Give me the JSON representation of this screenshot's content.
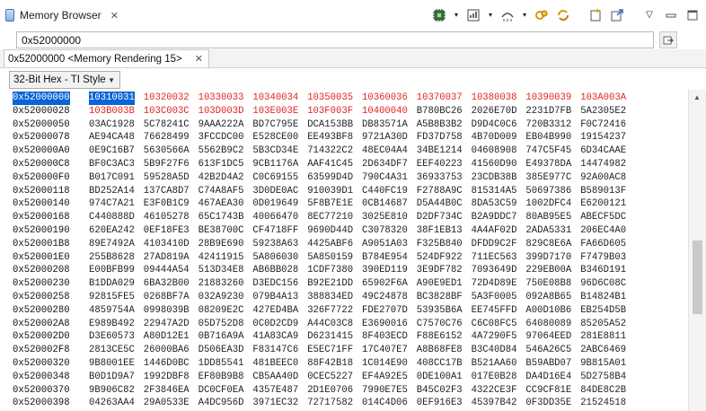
{
  "view": {
    "title": "Memory Browser",
    "close": "✕"
  },
  "toolbar": {
    "icons": [
      "chip-icon",
      "memory-map-icon",
      "chevron-down-icon",
      "interconnect-icon",
      "chevron-down-icon",
      "refresh-linked-icon",
      "sync-icon",
      "new-view-icon",
      "export-icon",
      "view-menu-icon",
      "minimize-icon",
      "maximize-icon"
    ]
  },
  "address_bar": {
    "value": "0x52000000",
    "go_icon": "go-icon"
  },
  "rendering_tab": {
    "label": "0x52000000 <Memory Rendering 15>",
    "close": "✕"
  },
  "format_select": {
    "selected": "32-Bit Hex - TI Style",
    "arrow": "▼"
  },
  "memory": {
    "rows": [
      {
        "addr": "0x52000000",
        "cells": [
          "10310031",
          "10320032",
          "10330033",
          "10340034",
          "10350035",
          "10360036",
          "10370037",
          "10380038",
          "10390039",
          "103A003A"
        ],
        "changed": [
          1,
          2,
          3,
          4,
          5,
          6,
          7,
          8,
          9
        ],
        "selected": [
          0
        ]
      },
      {
        "addr": "0x52000028",
        "cells": [
          "103B003B",
          "103C003C",
          "103D003D",
          "103E003E",
          "103F003F",
          "10400040",
          "B780BC26",
          "2026E70D",
          "2231D7FB",
          "5A2305E2"
        ],
        "changed": [
          0,
          1,
          2,
          3,
          4,
          5
        ],
        "selected": []
      },
      {
        "addr": "0x52000050",
        "cells": [
          "03AC1928",
          "5C78241C",
          "9AAA222A",
          "BD7C795E",
          "DCA153BB",
          "DB83571A",
          "A5B8B3B2",
          "D9D4C0C6",
          "720B3312",
          "F0C72416"
        ],
        "changed": [],
        "selected": []
      },
      {
        "addr": "0x52000078",
        "cells": [
          "AE94CA48",
          "76628499",
          "3FCCDC00",
          "E528CE00",
          "EE493BF8",
          "9721A30D",
          "FD37D758",
          "4B70D009",
          "EB04B990",
          "19154237"
        ],
        "changed": [],
        "selected": []
      },
      {
        "addr": "0x520000A0",
        "cells": [
          "0E9C16B7",
          "5630566A",
          "5562B9C2",
          "5B3CD34E",
          "714322C2",
          "48EC04A4",
          "34BE1214",
          "04608908",
          "747C5F45",
          "6D34CAAE"
        ],
        "changed": [],
        "selected": []
      },
      {
        "addr": "0x520000C8",
        "cells": [
          "BF0C3AC3",
          "5B9F27F6",
          "613F1DC5",
          "9CB1176A",
          "AAF41C45",
          "2D634DF7",
          "EEF40223",
          "41560D90",
          "E49378DA",
          "14474982"
        ],
        "changed": [],
        "selected": []
      },
      {
        "addr": "0x520000F0",
        "cells": [
          "B017C091",
          "59528A5D",
          "42B2D4A2",
          "C0C69155",
          "63599D4D",
          "790C4A31",
          "36933753",
          "23CDB38B",
          "385E977C",
          "92A00AC8"
        ],
        "changed": [],
        "selected": []
      },
      {
        "addr": "0x52000118",
        "cells": [
          "BD252A14",
          "137CA8D7",
          "C74A8AF5",
          "3D0DE0AC",
          "910039D1",
          "C440FC19",
          "F2788A9C",
          "815314A5",
          "50697386",
          "B589013F"
        ],
        "changed": [],
        "selected": []
      },
      {
        "addr": "0x52000140",
        "cells": [
          "974C7A21",
          "E3F0B1C9",
          "467AEA30",
          "0D019649",
          "5F8B7E1E",
          "0CB14687",
          "D5A44B0C",
          "8DA53C59",
          "1002DFC4",
          "E6200121"
        ],
        "changed": [],
        "selected": []
      },
      {
        "addr": "0x52000168",
        "cells": [
          "C440888D",
          "46105278",
          "65C1743B",
          "40066470",
          "8EC77210",
          "3025E810",
          "D2DF734C",
          "B2A9DDC7",
          "80AB95E5",
          "ABECF5DC"
        ],
        "changed": [],
        "selected": []
      },
      {
        "addr": "0x52000190",
        "cells": [
          "620EA242",
          "0EF18FE3",
          "BE38700C",
          "CF4718FF",
          "9690D44D",
          "C3078320",
          "38F1EB13",
          "4A4AF02D",
          "2ADA5331",
          "206EC4A0"
        ],
        "changed": [],
        "selected": []
      },
      {
        "addr": "0x520001B8",
        "cells": [
          "89E7492A",
          "4103410D",
          "28B9E690",
          "59238A63",
          "4425ABF6",
          "A9051A03",
          "F325B840",
          "DFDD9C2F",
          "829C8E6A",
          "FA66D605"
        ],
        "changed": [],
        "selected": []
      },
      {
        "addr": "0x520001E0",
        "cells": [
          "255B8628",
          "27AD819A",
          "42411915",
          "5A806030",
          "5A850159",
          "B784E954",
          "524DF922",
          "711EC563",
          "399D7170",
          "F7479B03"
        ],
        "changed": [],
        "selected": []
      },
      {
        "addr": "0x52000208",
        "cells": [
          "E00BFB99",
          "09444A54",
          "513D34E8",
          "AB6BB028",
          "1CDF7380",
          "390ED119",
          "3E9DF782",
          "7093649D",
          "229EB00A",
          "B346D191"
        ],
        "changed": [],
        "selected": []
      },
      {
        "addr": "0x52000230",
        "cells": [
          "B1DDA029",
          "6BA32B00",
          "21883260",
          "D3EDC156",
          "B92E21DD",
          "65902F6A",
          "A90E9ED1",
          "72D4D89E",
          "750E08B8",
          "96D6C08C"
        ],
        "changed": [],
        "selected": []
      },
      {
        "addr": "0x52000258",
        "cells": [
          "92815FE5",
          "0268BF7A",
          "032A9230",
          "079B4A13",
          "388834ED",
          "49C24878",
          "BC3828BF",
          "5A3F0005",
          "092A8B65",
          "B14824B1"
        ],
        "changed": [],
        "selected": []
      },
      {
        "addr": "0x52000280",
        "cells": [
          "4859754A",
          "0998039B",
          "08209E2C",
          "427ED4BA",
          "326F7722",
          "FDE2707D",
          "53935B6A",
          "EE745FFD",
          "A00D10B6",
          "EB254D5B"
        ],
        "changed": [],
        "selected": []
      },
      {
        "addr": "0x520002A8",
        "cells": [
          "E989B492",
          "22947A2D",
          "05D752D8",
          "0C0D2CD9",
          "A44C03C8",
          "E3690016",
          "C7570C76",
          "C6C08FC5",
          "64080089",
          "85205A52"
        ],
        "changed": [],
        "selected": []
      },
      {
        "addr": "0x520002D0",
        "cells": [
          "D3E60573",
          "A80D12E1",
          "0B716A9A",
          "41A83CA9",
          "D6231415",
          "8F403ECD",
          "F88E6152",
          "4A7290F5",
          "97064EED",
          "281E8811"
        ],
        "changed": [],
        "selected": []
      },
      {
        "addr": "0x520002F8",
        "cells": [
          "2813CE5C",
          "26000BA6",
          "D506EA3D",
          "F83147C6",
          "E5EC71FF",
          "17C407E7",
          "A8B68FE8",
          "B3C40D84",
          "546A26C5",
          "2ABC6469"
        ],
        "changed": [],
        "selected": []
      },
      {
        "addr": "0x52000320",
        "cells": [
          "9B8001EE",
          "1446D0BC",
          "1DD85541",
          "481BEEC0",
          "88F42B18",
          "1C014E90",
          "408CC17B",
          "B521AA60",
          "B59ABD07",
          "9B815A01"
        ],
        "changed": [],
        "selected": []
      },
      {
        "addr": "0x52000348",
        "cells": [
          "B0D1D9A7",
          "1992DBF8",
          "EF80B9B8",
          "CB5AA40D",
          "0CEC5227",
          "EF4A92E5",
          "0DE100A1",
          "017E0B28",
          "DA4D16E4",
          "5D2758B4"
        ],
        "changed": [],
        "selected": []
      },
      {
        "addr": "0x52000370",
        "cells": [
          "9B906C82",
          "2F3846EA",
          "DC0CF0EA",
          "4357E487",
          "2D1E0706",
          "7990E7E5",
          "B45C02F3",
          "4322CE3F",
          "CC9CF81E",
          "84DE8C2B"
        ],
        "changed": [],
        "selected": []
      },
      {
        "addr": "0x52000398",
        "cells": [
          "04263AA4",
          "29A0533E",
          "A4DC956D",
          "3971EC32",
          "72717582",
          "014C4D06",
          "0EF916E3",
          "45397B42",
          "0F3DD35E",
          "21524518"
        ],
        "changed": [],
        "selected": []
      }
    ]
  },
  "scrollbar": {
    "up_arrow": "▲"
  }
}
